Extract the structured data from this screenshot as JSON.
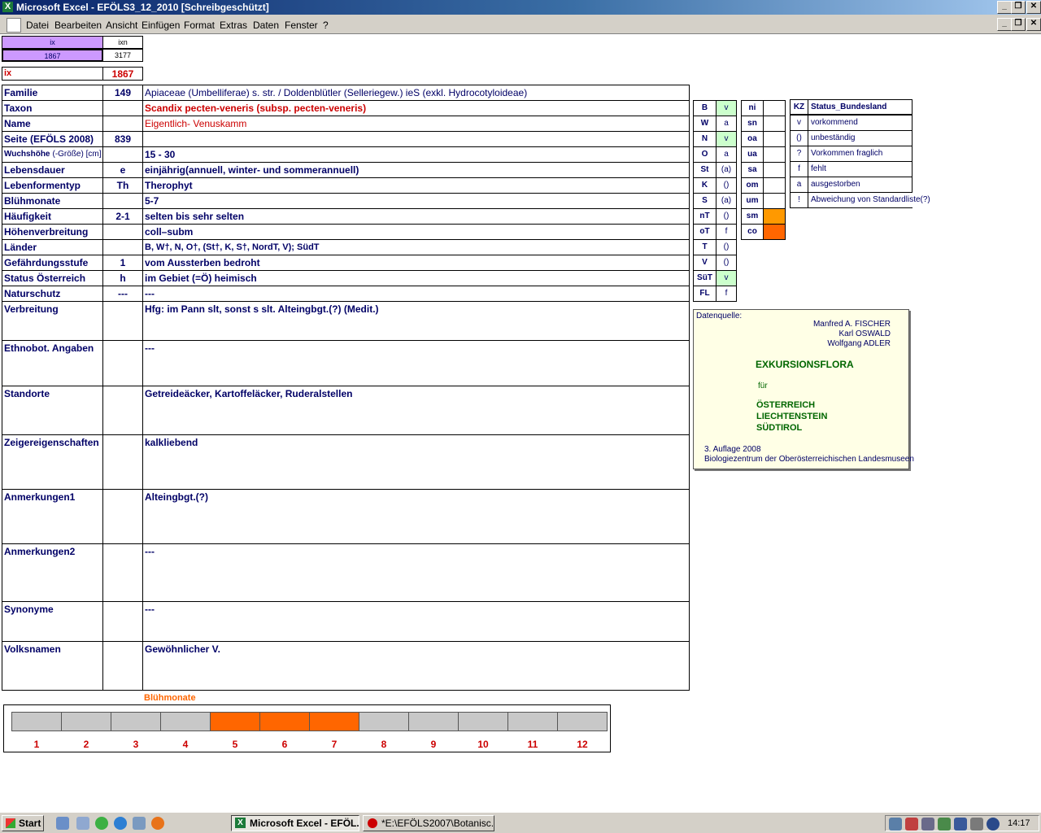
{
  "window": {
    "title": "Microsoft Excel - EFÖLS3_12_2010  [Schreibgeschützt]"
  },
  "caption_buttons": {
    "minimize": "_",
    "restore": "❐",
    "close": "✕"
  },
  "menu": {
    "items": [
      "Datei",
      "Bearbeiten",
      "Ansicht",
      "Einfügen",
      "Format",
      "Extras",
      "Daten",
      "Fenster",
      "?"
    ]
  },
  "index": {
    "ix_header": "ix",
    "ixn_header": "ixn",
    "ix_value": "1867",
    "ixn_value": "3177",
    "ix_label": "ix",
    "ix_big": "1867"
  },
  "rows": [
    {
      "label": "Familie",
      "num": "149",
      "text": "Apiaceae (Umbelliferae) s. str.  /  Doldenblütler (Selleriegew.) ieS (exkl. Hydrocotyloideae)"
    },
    {
      "label": "Taxon",
      "num": "",
      "text": "Scandix pecten-veneris (subsp. pecten-veneris)"
    },
    {
      "label": "Name",
      "num": "",
      "text": "Eigentlich- Venuskamm"
    },
    {
      "label": "Seite (EFÖLS 2008)",
      "num": "839",
      "text": ""
    },
    {
      "label": "Wuchshöhe",
      "label_suffix": "(-Größe) [cm]",
      "num": "",
      "text": " 15 - 30"
    },
    {
      "label": "Lebensdauer",
      "num": "e",
      "text": "einjährig(annuell, winter- und sommerannuell)"
    },
    {
      "label": "Lebenformentyp",
      "num": "Th",
      "text": "Therophyt"
    },
    {
      "label": "Blühmonate",
      "num": "",
      "text": " 5-7"
    },
    {
      "label": "Häufigkeit",
      "num": "2-1",
      "text": "selten bis sehr selten"
    },
    {
      "label": "Höhenverbreitung",
      "num": "",
      "text": "coll–subm"
    },
    {
      "label": "Länder",
      "num": "",
      "text": "B, W†, N, O†, (St†, K, S†, NordT, V); SüdT"
    },
    {
      "label": "Gefährdungsstufe",
      "num": "1",
      "text": "vom Aussterben bedroht"
    },
    {
      "label": "Status Österreich",
      "num": "h",
      "text": "im Gebiet (=Ö) heimisch"
    },
    {
      "label": "Naturschutz",
      "num": "---",
      "text": " ---"
    },
    {
      "label": "Verbreitung",
      "num": "",
      "text": "Hfg: im Pann slt, sonst s slt.  Alteingbgt.(?) (Medit.)"
    },
    {
      "label": "Ethnobot. Angaben",
      "num": "",
      "text": "---"
    },
    {
      "label": "Standorte",
      "num": "",
      "text": "Getreideäcker, Kartoffeläcker, Ruderalstellen"
    },
    {
      "label": "Zeigereigenschaften",
      "num": "",
      "text": "kalkliebend"
    },
    {
      "label": "Anmerkungen1",
      "num": "",
      "text": " Alteingbgt.(?)"
    },
    {
      "label": "Anmerkungen2",
      "num": "",
      "text": "---"
    },
    {
      "label": "Synonyme",
      "num": "",
      "text": "---"
    },
    {
      "label": "Volksnamen",
      "num": "",
      "text": "Gewöhnlicher V."
    }
  ],
  "regions": [
    {
      "code": "B",
      "val": "v",
      "green": true
    },
    {
      "code": "W",
      "val": "a",
      "green": false
    },
    {
      "code": "N",
      "val": "v",
      "green": true
    },
    {
      "code": "O",
      "val": "a",
      "green": false
    },
    {
      "code": "St",
      "val": "(a)",
      "green": false
    },
    {
      "code": "K",
      "val": "()",
      "green": false
    },
    {
      "code": "S",
      "val": "(a)",
      "green": false
    },
    {
      "code": "nT",
      "val": "()",
      "green": false
    },
    {
      "code": "oT",
      "val": "f",
      "green": false
    },
    {
      "code": "T",
      "val": "()",
      "green": false
    },
    {
      "code": "V",
      "val": "()",
      "green": false
    },
    {
      "code": "SüT",
      "val": "v",
      "green": true
    },
    {
      "code": "FL",
      "val": "f",
      "green": false
    }
  ],
  "altitude": [
    {
      "code": "ni",
      "active": false
    },
    {
      "code": "sn",
      "active": false
    },
    {
      "code": "oa",
      "active": false
    },
    {
      "code": "ua",
      "active": false
    },
    {
      "code": "sa",
      "active": false
    },
    {
      "code": "om",
      "active": false
    },
    {
      "code": "um",
      "active": false
    },
    {
      "code": "sm",
      "active": true
    },
    {
      "code": "co",
      "active": true
    }
  ],
  "legend": {
    "kz": "KZ",
    "heading": "Status_Bundesland",
    "items": [
      {
        "k": "v",
        "t": "vorkommend"
      },
      {
        "k": "()",
        "t": "unbeständig"
      },
      {
        "k": "?",
        "t": "Vorkommen fraglich"
      },
      {
        "k": "f",
        "t": "fehlt"
      },
      {
        "k": "a",
        "t": "ausgestorben"
      },
      {
        "k": "!",
        "t": "Abweichung von Standardliste(?)"
      }
    ]
  },
  "source": {
    "label": "Datenquelle:",
    "authors": [
      "Manfred A. FISCHER",
      "Karl OSWALD",
      "Wolfgang ADLER"
    ],
    "title": "EXKURSIONSFLORA",
    "fuer": "für",
    "countries": [
      "ÖSTERREICH",
      "LIECHTENSTEIN",
      "SÜDTIROL"
    ],
    "edition": "3. Auflage 2008",
    "publisher": "Biologiezentrum der Oberösterreichischen Landesmuseen"
  },
  "bloom": {
    "title": "Blühmonate",
    "months": [
      "1",
      "2",
      "3",
      "4",
      "5",
      "6",
      "7",
      "8",
      "9",
      "10",
      "11",
      "12"
    ],
    "active": [
      5,
      6,
      7
    ],
    "colors": {
      "active": "#ff6600",
      "inactive": "#c8c8c8"
    }
  },
  "taskbar": {
    "start": "Start",
    "tasks": [
      "Microsoft Excel - EFÖL...",
      "*E:\\EFÖLS2007\\Botanisc..."
    ],
    "clock": "14:17"
  }
}
